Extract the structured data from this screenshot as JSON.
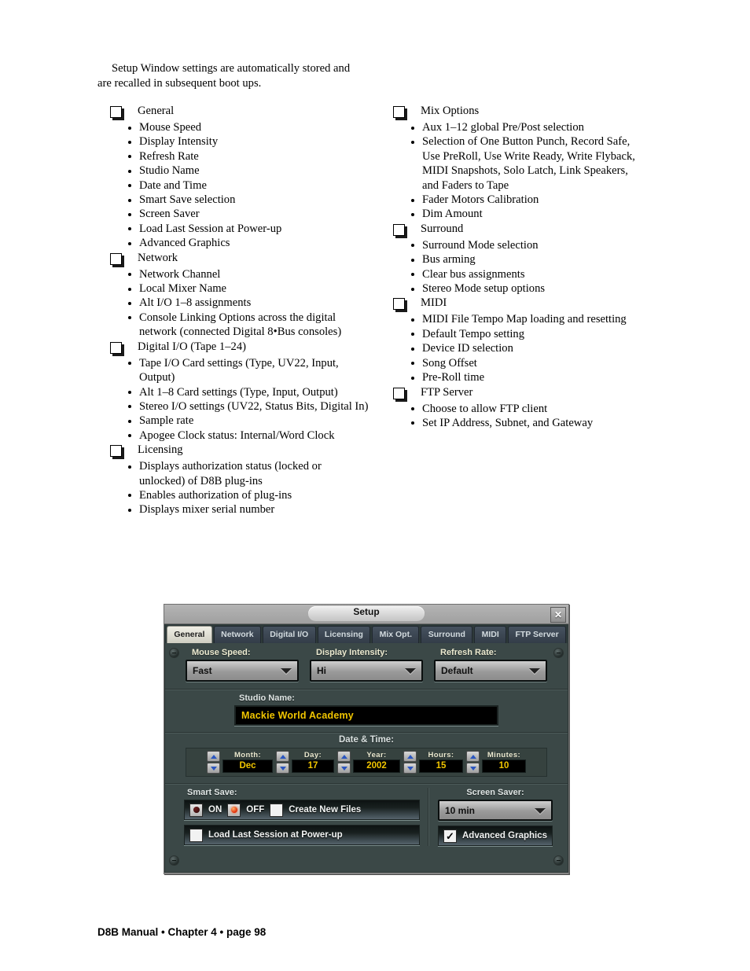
{
  "intro": "Setup Window settings are automatically stored and are recalled in subsequent boot ups.",
  "outline": {
    "left": [
      {
        "group": "General",
        "items": [
          "Mouse Speed",
          "Display Intensity",
          "Refresh Rate",
          "Studio Name",
          "Date and Time",
          "Smart Save selection",
          "Screen Saver",
          "Load Last Session at Power-up",
          "Advanced Graphics"
        ]
      },
      {
        "group": "Network",
        "items": [
          "Network Channel",
          "Local Mixer Name",
          "Alt I/O 1–8 assignments",
          "Console Linking Options across the digital network (connected Digital 8•Bus consoles)"
        ]
      },
      {
        "group": "Digital I/O (Tape 1–24)",
        "items": [
          "Tape I/O Card settings (Type, UV22, Input, Output)",
          "Alt 1–8 Card settings (Type, Input, Output)",
          "Stereo I/O settings (UV22, Status Bits, Digital In)",
          "Sample rate",
          "Apogee Clock status: Internal/Word Clock"
        ]
      },
      {
        "group": "Licensing",
        "items": [
          "Displays authorization status (locked or unlocked) of D8B plug-ins",
          "Enables authorization of plug-ins",
          "Displays mixer serial number"
        ]
      }
    ],
    "right": [
      {
        "group": "Mix Options",
        "items": [
          "Aux 1–12 global Pre/Post selection",
          "Selection of One Button Punch, Record Safe, Use PreRoll, Use Write Ready, Write Flyback, MIDI Snapshots, Solo Latch, Link Speakers, and Faders to Tape",
          "Fader Motors Calibration",
          "Dim Amount"
        ]
      },
      {
        "group": "Surround",
        "items": [
          "Surround Mode selection",
          "Bus arming",
          "Clear bus assignments",
          "Stereo Mode setup options"
        ]
      },
      {
        "group": "MIDI",
        "items": [
          "MIDI File Tempo Map loading and resetting",
          "Default Tempo setting",
          "Device ID selection",
          "Song Offset",
          "Pre-Roll time"
        ]
      },
      {
        "group": "FTP Server",
        "items": [
          "Choose to allow FTP client",
          "Set IP Address, Subnet, and Gateway"
        ]
      }
    ]
  },
  "dialog": {
    "title": "Setup",
    "close_icon": "close-icon",
    "tabs": [
      {
        "label": "General",
        "active": true
      },
      {
        "label": "Network",
        "active": false
      },
      {
        "label": "Digital I/O",
        "active": false
      },
      {
        "label": "Licensing",
        "active": false
      },
      {
        "label": "Mix Opt.",
        "active": false
      },
      {
        "label": "Surround",
        "active": false
      },
      {
        "label": "MIDI",
        "active": false
      },
      {
        "label": "FTP Server",
        "active": false
      }
    ],
    "mouse_speed": {
      "label": "Mouse Speed:",
      "value": "Fast"
    },
    "display_intensity": {
      "label": "Display Intensity:",
      "value": "Hi"
    },
    "refresh_rate": {
      "label": "Refresh Rate:",
      "value": "Default"
    },
    "studio_name": {
      "label": "Studio Name:",
      "value": "Mackie World Academy"
    },
    "date_time": {
      "label": "Date & Time:",
      "fields": [
        {
          "label": "Month:",
          "value": "Dec"
        },
        {
          "label": "Day:",
          "value": "17"
        },
        {
          "label": "Year:",
          "value": "2002"
        },
        {
          "label": "Hours:",
          "value": "15"
        },
        {
          "label": "Minutes:",
          "value": "10"
        }
      ]
    },
    "smart_save": {
      "label": "Smart Save:",
      "on_label": "ON",
      "off_label": "OFF",
      "create_new_files_label": "Create New Files",
      "load_last_session_label": "Load Last Session at Power-up"
    },
    "screen_saver": {
      "label": "Screen Saver:",
      "value": "10 min",
      "advanced_graphics_label": "Advanced Graphics",
      "advanced_graphics_mark": "✓"
    },
    "colors": {
      "panel": "#3b4847",
      "titlebar": "#a8a8a8",
      "tab_active": "#e6e5da",
      "tab_inactive": "#3c4855",
      "field_text": "#f0c500",
      "label_text": "#ecead0",
      "led_on": "#e02a08"
    }
  },
  "footer": "D8B Manual • Chapter 4 • page  98"
}
